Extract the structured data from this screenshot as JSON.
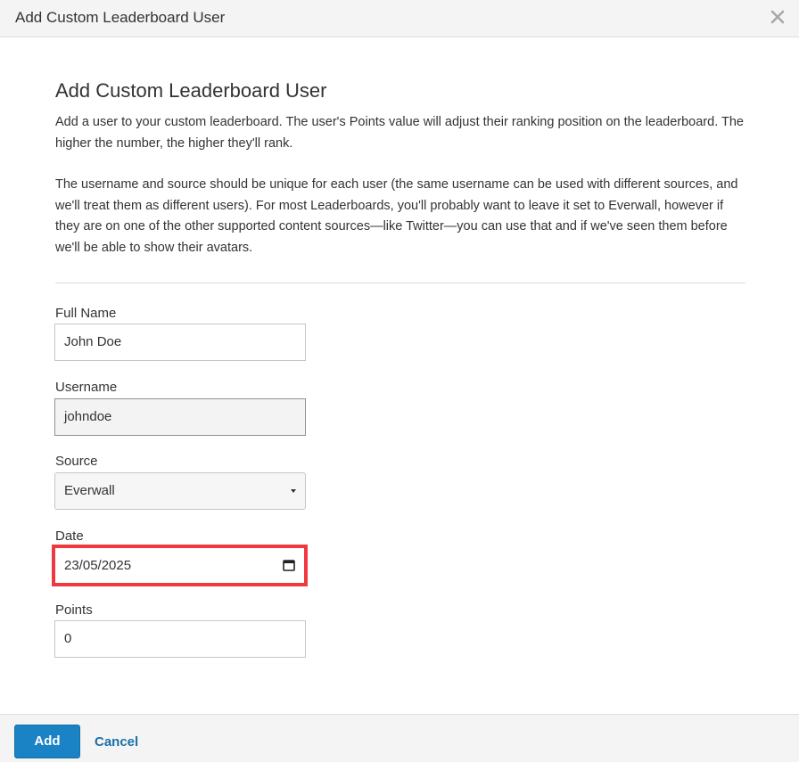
{
  "header": {
    "title": "Add Custom Leaderboard User",
    "close_icon": "close-icon"
  },
  "body": {
    "title": "Add Custom Leaderboard User",
    "description_1": "Add a user to your custom leaderboard. The user's Points value will adjust their ranking position on the leaderboard. The higher the number, the higher they'll rank.",
    "description_2": "The username and source should be unique for each user (the same username can be used with different sources, and we'll treat them as different users). For most Leaderboards, you'll probably want to leave it set to Everwall, however if they are on one of the other supported content sources—like Twitter—you can use that and if we've seen them before we'll be able to show their avatars."
  },
  "form": {
    "full_name": {
      "label": "Full Name",
      "value": "John Doe"
    },
    "username": {
      "label": "Username",
      "value": "johndoe"
    },
    "source": {
      "label": "Source",
      "value": "Everwall"
    },
    "date": {
      "label": "Date",
      "value": "23/05/2025",
      "icon": "calendar-icon"
    },
    "points": {
      "label": "Points",
      "value": "0"
    }
  },
  "footer": {
    "add_label": "Add",
    "cancel_label": "Cancel"
  },
  "colors": {
    "primary": "#1a83c6",
    "link": "#1a6fa8",
    "highlight": "#f0393f"
  }
}
